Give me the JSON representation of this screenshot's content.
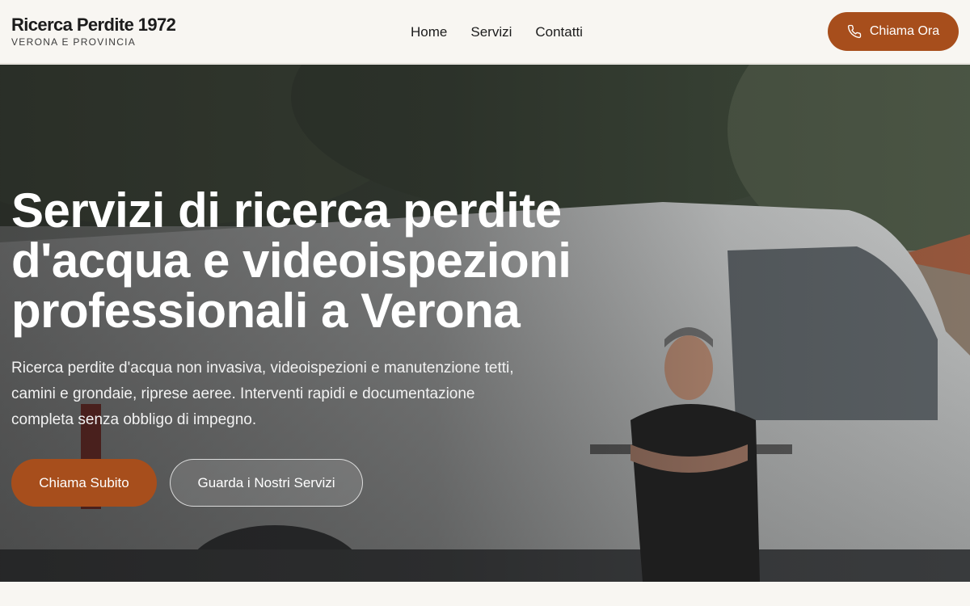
{
  "header": {
    "brand_name": "Ricerca Perdite 1972",
    "brand_sub": "VERONA E PROVINCIA",
    "nav": [
      "Home",
      "Servizi",
      "Contatti"
    ],
    "call_label": "Chiama Ora",
    "call_icon": "phone-icon"
  },
  "hero": {
    "title": "Servizi di ricerca perdite d'acqua e videoispezioni professionali a Verona",
    "text": "Ricerca perdite d'acqua non invasiva, videoispezioni e manutenzione tetti, camini e grondaie, riprese aeree. Interventi rapidi e documentazione completa senza obbligo di impegno.",
    "primary_label": "Chiama Subito",
    "secondary_label": "Guarda i Nostri Servizi"
  },
  "colors": {
    "accent": "#a74e1c",
    "background": "#f8f6f2"
  }
}
